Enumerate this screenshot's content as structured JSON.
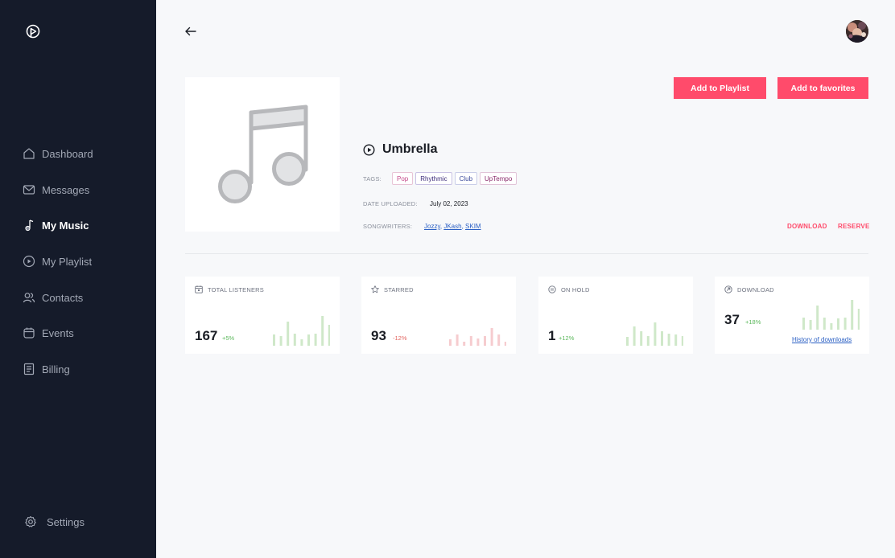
{
  "sidebar": {
    "items": [
      {
        "label": "Dashboard",
        "icon": "home-icon"
      },
      {
        "label": "Messages",
        "icon": "mail-icon"
      },
      {
        "label": "My Music",
        "icon": "music-note-icon"
      },
      {
        "label": "My Playlist",
        "icon": "play-circle-icon"
      },
      {
        "label": "Contacts",
        "icon": "users-icon"
      },
      {
        "label": "Events",
        "icon": "calendar-icon"
      },
      {
        "label": "Billing",
        "icon": "receipt-icon"
      }
    ],
    "active_item": "My Music",
    "settings_label": "Settings"
  },
  "actions": {
    "add_to_playlist": "Add to Playlist",
    "add_to_favorites": "Add to favorites",
    "download": "DOWNLOAD",
    "reserve": "RESERVE"
  },
  "song": {
    "title": "Umbrella",
    "tags_label": "TAGS:",
    "tags": [
      "Pop",
      "Rhythmic",
      "Club",
      "UpTempo"
    ],
    "date_label": "DATE UPLOADED:",
    "date": "July 02, 2023",
    "songwriters_label": "SONGWRITERS:",
    "songwriters": [
      "Jozzy",
      "JKash",
      "SKIM"
    ],
    "songwriters_separator": ","
  },
  "stats": [
    {
      "title": "TOTAL LISTENERS",
      "value": "167",
      "change": "+5%",
      "trend": "up",
      "bars": [
        14,
        12,
        30,
        15,
        8,
        14,
        15,
        37,
        26
      ]
    },
    {
      "title": "STARRED",
      "value": "93",
      "change": "-12%",
      "trend": "down",
      "bars": [
        8,
        14,
        5,
        12,
        9,
        12,
        22,
        14,
        5
      ]
    },
    {
      "title": "ON HOLD",
      "value": "1",
      "change": "+12%",
      "trend": "up",
      "bars": [
        11,
        24,
        18,
        12,
        29,
        18,
        15,
        14,
        12
      ]
    },
    {
      "title": "DOWNLOAD",
      "value": "37",
      "change": "+18%",
      "trend": "up",
      "bars": [
        15,
        12,
        30,
        15,
        8,
        14,
        15,
        37,
        26
      ],
      "link": "History of downloads"
    }
  ],
  "colors": {
    "accent": "#ff4b6b",
    "sidebar_bg": "#151b2a",
    "up_bar": "#cfe8c9",
    "down_bar": "#f6cccf",
    "link": "#2a5fc4"
  }
}
